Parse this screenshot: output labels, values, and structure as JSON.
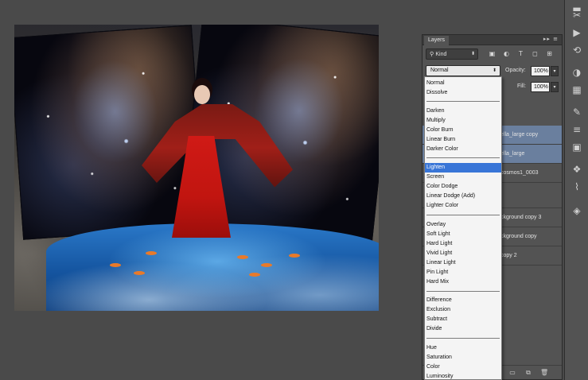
{
  "layers_panel": {
    "tab_label": "Layers",
    "menu_glyph": "▸▸ ≡",
    "kind_filter": "Kind",
    "blend_mode": "Normal",
    "opacity_label": "Opacity:",
    "opacity_value": "100%",
    "fill_label": "Fill:",
    "fill_value": "100%",
    "layers": [
      {
        "name": "ella_large copy",
        "selected": true
      },
      {
        "name": "ella_large",
        "selected": true
      },
      {
        "name": "cosmos1_0003",
        "selected": false
      },
      {
        "name": "",
        "selected": false
      },
      {
        "name": "ckground copy 3",
        "selected": false
      },
      {
        "name": "ckground copy",
        "selected": false
      },
      {
        "name": "copy 2",
        "selected": false
      }
    ],
    "footer_icons": [
      "folder-icon",
      "new-layer-icon",
      "trash-icon"
    ]
  },
  "blend_menu": {
    "groups": [
      [
        "Normal",
        "Dissolve"
      ],
      [
        "Darken",
        "Multiply",
        "Color Burn",
        "Linear Burn",
        "Darker Color"
      ],
      [
        "Lighten",
        "Screen",
        "Color Dodge",
        "Linear Dodge (Add)",
        "Lighter Color"
      ],
      [
        "Overlay",
        "Soft Light",
        "Hard Light",
        "Vivid Light",
        "Linear Light",
        "Pin Light",
        "Hard Mix"
      ],
      [
        "Difference",
        "Exclusion",
        "Subtract",
        "Divide"
      ],
      [
        "Hue",
        "Saturation",
        "Color",
        "Luminosity"
      ]
    ],
    "highlighted": "Lighten"
  },
  "tools": [
    "scissors-icon",
    "play-icon",
    "history-icon",
    "color-icon",
    "brush-icon",
    "adjust-icon",
    "swatch-icon",
    "styles-icon",
    "path-icon",
    "layers-icon"
  ],
  "colors": {
    "highlight": "#3875d7",
    "selected_layer": "#6a7f9e",
    "panel_bg": "#535353"
  }
}
